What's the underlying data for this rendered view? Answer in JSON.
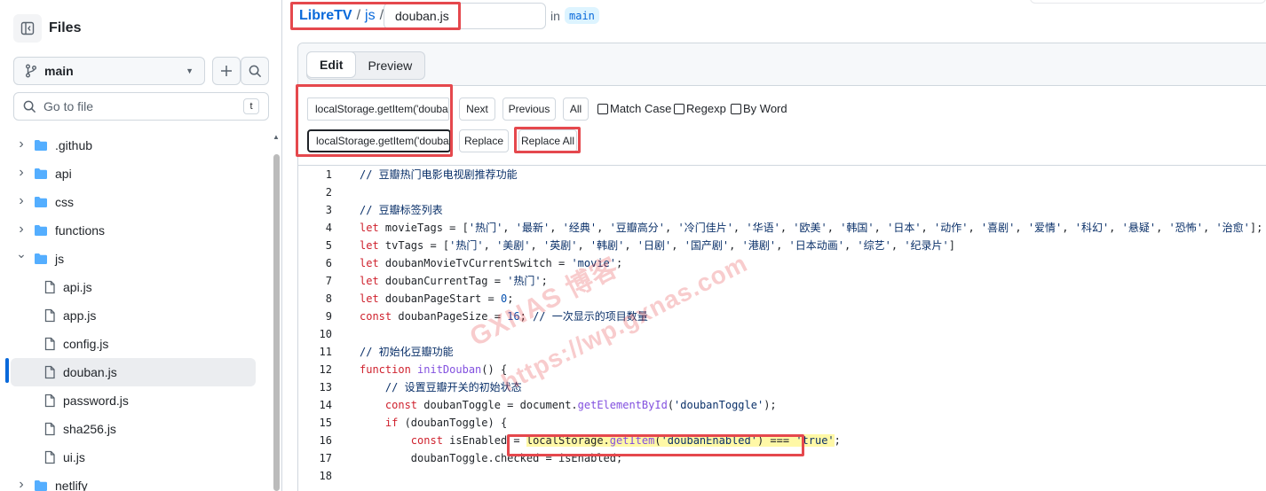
{
  "sidebar": {
    "title": "Files",
    "branch": "main",
    "goto_placeholder": "Go to file",
    "goto_shortcut": "t",
    "tree": [
      {
        "label": ".github",
        "kind": "folder",
        "expanded": false
      },
      {
        "label": "api",
        "kind": "folder",
        "expanded": false
      },
      {
        "label": "css",
        "kind": "folder",
        "expanded": false
      },
      {
        "label": "functions",
        "kind": "folder",
        "expanded": false
      },
      {
        "label": "js",
        "kind": "folder",
        "expanded": true
      },
      {
        "label": "api.js",
        "kind": "file"
      },
      {
        "label": "app.js",
        "kind": "file"
      },
      {
        "label": "config.js",
        "kind": "file"
      },
      {
        "label": "douban.js",
        "kind": "file",
        "selected": true
      },
      {
        "label": "password.js",
        "kind": "file"
      },
      {
        "label": "sha256.js",
        "kind": "file"
      },
      {
        "label": "ui.js",
        "kind": "file"
      },
      {
        "label": "netlify",
        "kind": "folder",
        "expanded": false
      }
    ]
  },
  "header": {
    "repo": "LibreTV",
    "folder": "js",
    "separator": "/",
    "filename": "douban.js",
    "in_text": "in",
    "branch": "main"
  },
  "tabs": [
    {
      "label": "Edit",
      "active": true
    },
    {
      "label": "Preview",
      "active": false
    }
  ],
  "find": {
    "search_value": "localStorage.getItem('doubanEnabled') === 'true'",
    "replace_value": "localStorage.getItem('doubanEnabled') !== 'false'",
    "next": "Next",
    "previous": "Previous",
    "all": "All",
    "match_case": "Match Case",
    "regexp": "Regexp",
    "by_word": "By Word",
    "replace": "Replace",
    "replace_all": "Replace All"
  },
  "code_lines": [
    "// 豆瓣热门电影电视剧推荐功能",
    "",
    "// 豆瓣标签列表",
    "let movieTags = ['热门', '最新', '经典', '豆瓣高分', '冷门佳片', '华语', '欧美', '韩国', '日本', '动作', '喜剧', '爱情', '科幻', '悬疑', '恐怖', '治愈'];",
    "let tvTags = ['热门', '美剧', '英剧', '韩剧', '日剧', '国产剧', '港剧', '日本动画', '综艺', '纪录片']",
    "let doubanMovieTvCurrentSwitch = 'movie';",
    "let doubanCurrentTag = '热门';",
    "let doubanPageStart = 0;",
    "const doubanPageSize = 16; // 一次显示的项目数量",
    "",
    "// 初始化豆瓣功能",
    "function initDouban() {",
    "    // 设置豆瓣开关的初始状态",
    "    const doubanToggle = document.getElementById('doubanToggle');",
    "    if (doubanToggle) {",
    "        const isEnabled = localStorage.getItem('doubanEnabled') === 'true';",
    "        doubanToggle.checked = isEnabled;",
    ""
  ],
  "watermark": [
    "GXNAS 博客",
    "https://wp.gxnas.com"
  ]
}
